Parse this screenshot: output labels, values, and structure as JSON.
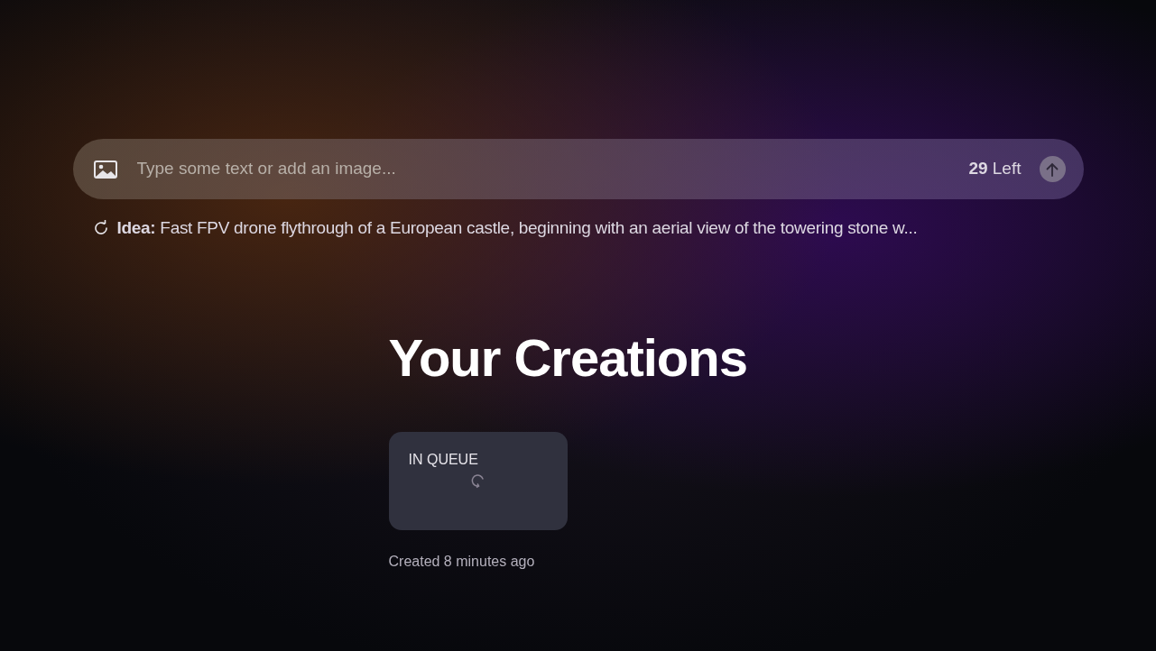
{
  "prompt_bar": {
    "placeholder": "Type some text or add an image...",
    "credits": "**29** Left"
  },
  "idea": "**Idea:** Fast FPV drone flythrough of a European castle, beginning with an aerial view of the towering stone w...",
  "heading": "Your Creations",
  "creations": [
    {
      "status": "IN QUEUE",
      "created": "Created 8 minutes ago"
    }
  ]
}
